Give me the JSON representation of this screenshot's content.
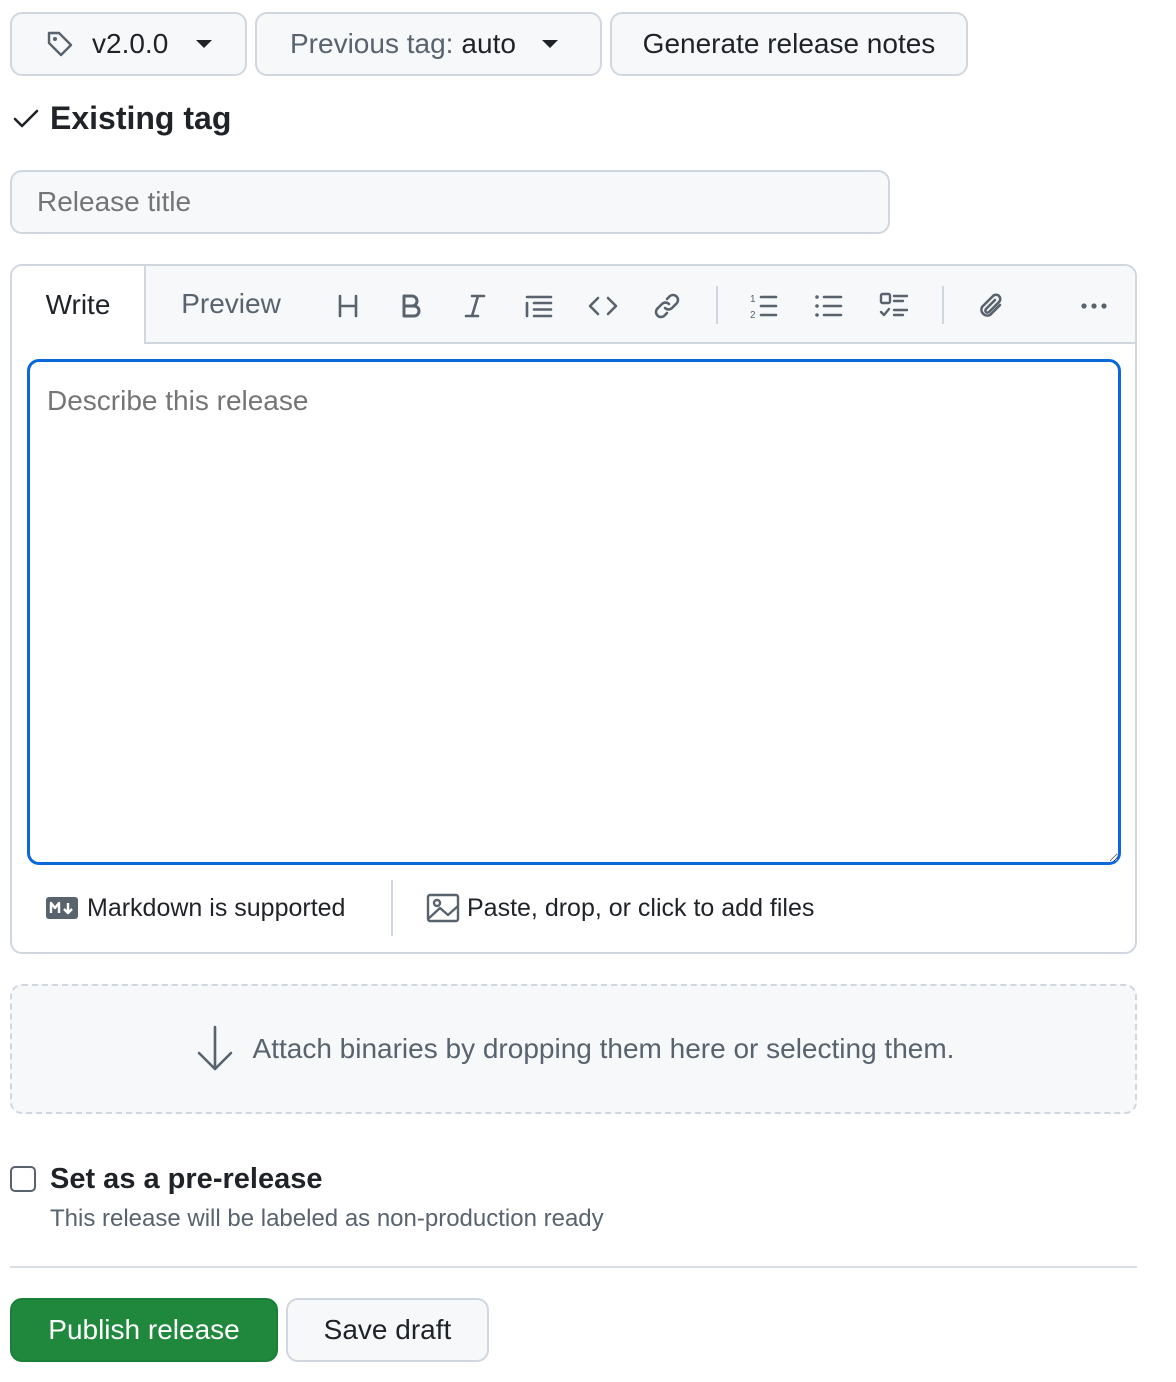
{
  "tag_select": {
    "label": "v2.0.0",
    "icon": "tag-icon"
  },
  "previous_tag": {
    "label": "Previous tag:",
    "value": "auto"
  },
  "generate_notes": {
    "label": "Generate release notes"
  },
  "tag_status": {
    "label": "Existing tag",
    "icon": "check-icon"
  },
  "release_title": {
    "placeholder": "Release title",
    "value": ""
  },
  "editor": {
    "tabs": {
      "write": "Write",
      "preview": "Preview"
    },
    "toolbar": [
      "heading-icon",
      "bold-icon",
      "italic-icon",
      "quote-icon",
      "code-icon",
      "link-icon",
      "ordered-list-icon",
      "unordered-list-icon",
      "task-list-icon",
      "attach-icon",
      "more-icon"
    ],
    "placeholder": "Describe this release",
    "value": "",
    "markdown_note": "Markdown is supported",
    "files_note": "Paste, drop, or click to add files"
  },
  "binaries": {
    "label": "Attach binaries by dropping them here or selecting them."
  },
  "prerelease": {
    "label": "Set as a pre-release",
    "description": "This release will be labeled as non-production ready",
    "checked": false
  },
  "actions": {
    "publish": "Publish release",
    "save_draft": "Save draft"
  },
  "colors": {
    "accent": "#0969da",
    "publish": "#1f883d",
    "border": "#d0d7de",
    "muted": "#59636e"
  }
}
